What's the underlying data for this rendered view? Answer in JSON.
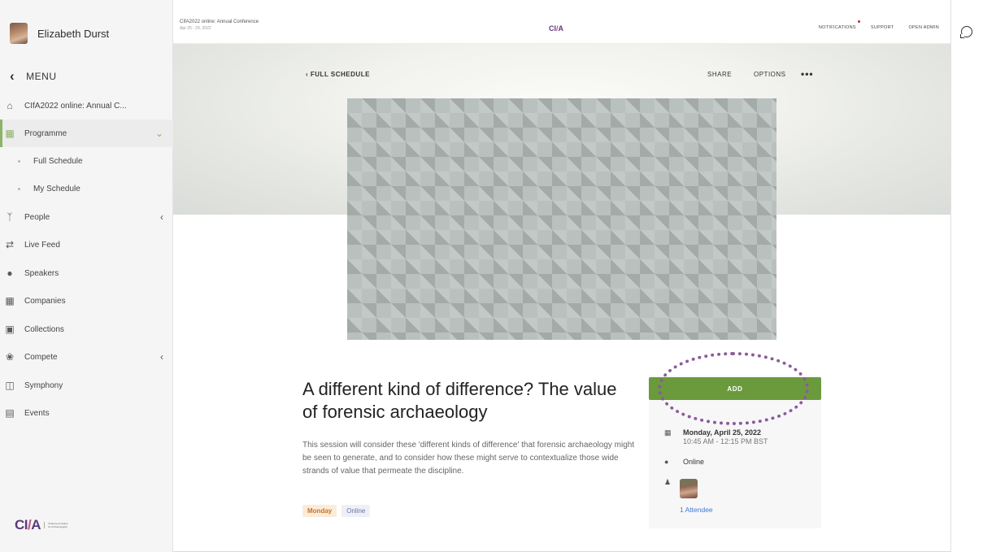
{
  "user": {
    "name": "Elizabeth Durst"
  },
  "menu": {
    "label": "MENU"
  },
  "sidebar": {
    "items": [
      {
        "label": "CIfA2022 online: Annual C...",
        "icon": "home-icon"
      },
      {
        "label": "Programme",
        "icon": "calendar-icon",
        "active": true
      },
      {
        "label": "Full Schedule"
      },
      {
        "label": "My Schedule"
      },
      {
        "label": "People",
        "icon": "people-icon"
      },
      {
        "label": "Live Feed",
        "icon": "live-feed-icon"
      },
      {
        "label": "Speakers",
        "icon": "speaker-icon"
      },
      {
        "label": "Companies",
        "icon": "building-icon"
      },
      {
        "label": "Collections",
        "icon": "collection-icon"
      },
      {
        "label": "Compete",
        "icon": "medal-icon"
      },
      {
        "label": "Symphony",
        "icon": "symphony-icon"
      },
      {
        "label": "Events",
        "icon": "ticket-icon"
      }
    ],
    "logo_tagline": "Chartered Institute for Archaeologists"
  },
  "topbar": {
    "conference_title": "CIfA2022 online: Annual Conference",
    "conference_dates": "Apr 25 - 29, 2022",
    "logo_text": "CI",
    "logo_slash": "/",
    "logo_tail": "A",
    "links": {
      "notifications": "NOTIFICATIONS",
      "support": "SUPPORT",
      "open_admin": "OPEN ADMIN"
    }
  },
  "session": {
    "back_label": "FULL SCHEDULE",
    "share_label": "SHARE",
    "options_label": "OPTIONS",
    "more_label": "•••",
    "title": "A different kind of difference? The value of forensic archaeology",
    "description": "This session will consider these 'different kinds of difference' that forensic archaeology might be seen to generate, and to consider how these might serve to contextualize those wide strands of value that permeate the discipline.",
    "tags": {
      "day": "Monday",
      "mode": "Online"
    },
    "add_label": "ADD",
    "date": "Monday, April 25, 2022",
    "time": "10:45 AM - 12:15 PM BST",
    "location": "Online",
    "attendees_label": "1 Attendee"
  },
  "colors": {
    "accent_green": "#6b9a3c",
    "highlight_purple": "#8c5a9c",
    "brand_purple": "#5b3a7a"
  }
}
